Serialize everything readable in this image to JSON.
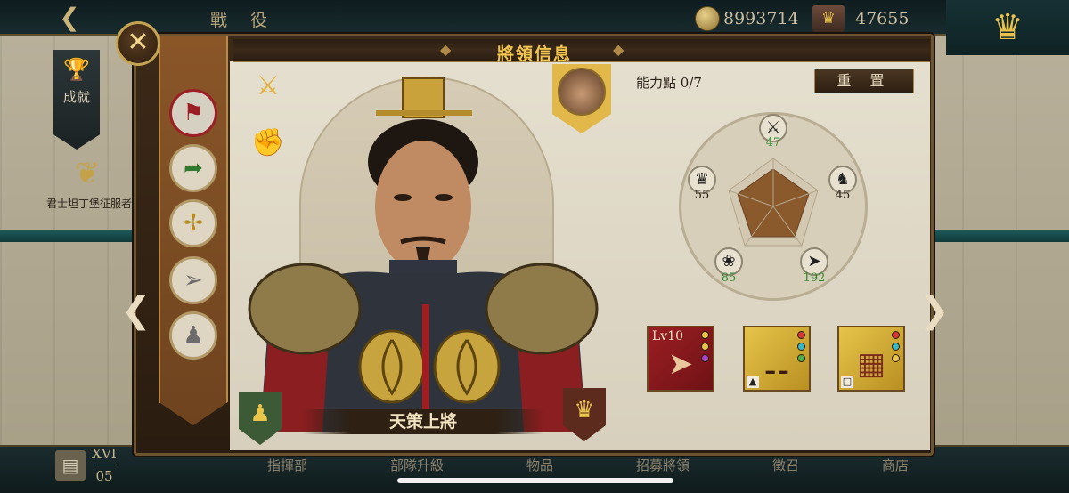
{
  "top_bar": {
    "title": "戰 役",
    "back_icon": "back-arrow-icon",
    "gold": "8993714",
    "crowns": "47655"
  },
  "side": {
    "achievements_label": "成就",
    "conquest_label": "君士坦丁堡征服者"
  },
  "panel": {
    "title": "將領信息",
    "close_icon": "close-icon",
    "general_title": "天策上將",
    "ability_points_label": "能力點 0/7",
    "reset_label": "重 置",
    "class_tabs": [
      {
        "name": "banner-class-icon",
        "active": true
      },
      {
        "name": "cavalry-archer-class-icon",
        "active": false
      },
      {
        "name": "crossbow-class-icon",
        "active": false
      },
      {
        "name": "archer-class-icon",
        "active": false
      },
      {
        "name": "hooded-class-icon",
        "active": false
      }
    ],
    "tools": [
      "crossed-swords-shield-icon",
      "handshake-icon"
    ]
  },
  "stats": {
    "attack": {
      "icon": "crossed-swords-icon",
      "value": "47",
      "color": "#2e8a2e"
    },
    "leadership": {
      "icon": "crown-icon",
      "value": "55",
      "color": "#222222"
    },
    "cavalry": {
      "icon": "knight-icon",
      "value": "45",
      "color": "#222222"
    },
    "defense": {
      "icon": "eagle-icon",
      "value": "85",
      "color": "#2e8a2e"
    },
    "ranged": {
      "icon": "bow-icon",
      "value": "192",
      "color": "#2e8a2e"
    }
  },
  "equipment": [
    {
      "name": "bow",
      "level": "Lv10",
      "bg": "red"
    },
    {
      "name": "cannon",
      "level": "",
      "bg": "gold"
    },
    {
      "name": "book",
      "level": "",
      "bg": "gold"
    }
  ],
  "bottom_tabs": [
    "指揮部",
    "部隊升級",
    "物品",
    "招募將領",
    "徵召",
    "商店"
  ],
  "page_indicator": {
    "top": "XVI",
    "bottom": "05"
  }
}
